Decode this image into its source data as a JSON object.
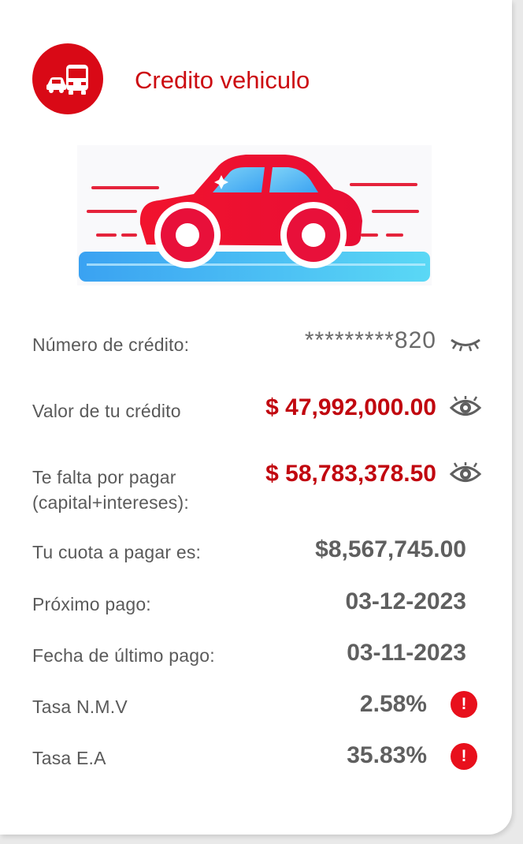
{
  "card": {
    "title": "Credito vehiculo",
    "logo_icon": "vehicle-bus-car-icon",
    "illustration_icon": "red-car-illustration"
  },
  "details": {
    "credit_number": {
      "label": "Número de crédito:",
      "value": "*********820",
      "toggle_icon": "eye-closed-icon"
    },
    "credit_value": {
      "label": "Valor de tu crédito",
      "value": "$ 47,992,000.00",
      "toggle_icon": "eye-open-icon"
    },
    "remaining": {
      "label_line1": "Te falta por pagar",
      "label_line2": "(capital+intereses):",
      "value": "$ 58,783,378.50",
      "toggle_icon": "eye-open-icon"
    },
    "installment": {
      "label": "Tu cuota a pagar es:",
      "value": "$8,567,745.00"
    },
    "next_payment": {
      "label": "Próximo pago:",
      "value": "03-12-2023"
    },
    "last_payment": {
      "label": "Fecha de último pago:",
      "value": "03-11-2023"
    },
    "rate_nmv": {
      "label": "Tasa N.M.V",
      "value": "2.58%",
      "info_icon": "alert-icon",
      "info_glyph": "!"
    },
    "rate_ea": {
      "label": "Tasa E.A",
      "value": "35.83%",
      "info_icon": "alert-icon",
      "info_glyph": "!"
    }
  },
  "colors": {
    "brand_red": "#d90916",
    "value_red": "#c1070f",
    "text_gray": "#5a5a5a"
  }
}
